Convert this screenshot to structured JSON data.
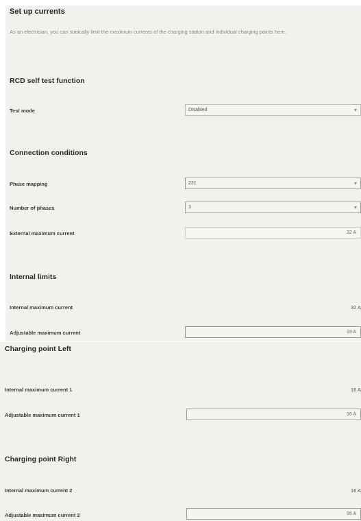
{
  "header": {
    "title": "Set up currents",
    "description": "As an electrician, you can statically limit the maximum currents of the charging station and individual charging points here."
  },
  "rcd": {
    "title": "RCD self test function",
    "test_mode_label": "Test mode",
    "test_mode_value": "Disabled"
  },
  "connection": {
    "title": "Connection conditions",
    "phase_mapping_label": "Phase mapping",
    "phase_mapping_value": "231",
    "phases_label": "Number of phases",
    "phases_value": "3",
    "ext_max_label": "External maximum current",
    "ext_max_value": "32 A"
  },
  "internal": {
    "title": "Internal limits",
    "int_max_label": "Internal maximum current",
    "int_max_value": "32 A",
    "adj_max_label": "Adjustable maximum current",
    "adj_max_value": "19 A"
  },
  "cp_left": {
    "title": "Charging point Left",
    "int_max_label": "Internal maximum current 1",
    "int_max_value": "16 A",
    "adj_max_label": "Adjustable maximum current 1",
    "adj_max_value": "16 A"
  },
  "cp_right": {
    "title": "Charging point Right",
    "int_max_label": "Internal maximum current 2",
    "int_max_value": "16 A",
    "adj_max_label": "Adjustable maximum current 2",
    "adj_max_value": "16 A"
  },
  "icons": {
    "dropdown": "chevron-down-icon"
  }
}
